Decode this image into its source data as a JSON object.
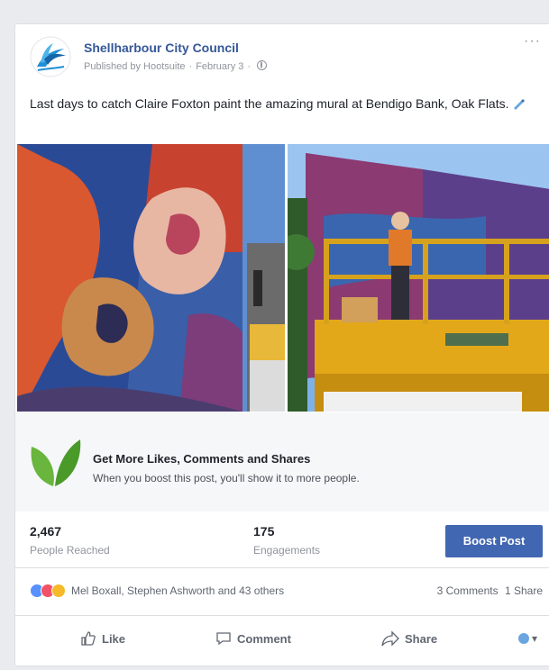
{
  "post": {
    "page_name": "Shellharbour City Council",
    "published_by": "Published by Hootsuite",
    "date": "February 3",
    "more_label": "···",
    "text": "Last days to catch Claire Foxton paint the amazing mural at Bendigo Bank, Oak Flats.",
    "images": [
      "mural-closeup-photo",
      "artist-on-scissor-lift-photo"
    ]
  },
  "promo": {
    "title": "Get More Likes, Comments and Shares",
    "subtitle": "When you boost this post, you'll show it to more people."
  },
  "stats": {
    "reached_value": "2,467",
    "reached_label": "People Reached",
    "engagements_value": "175",
    "engagements_label": "Engagements",
    "boost_label": "Boost Post"
  },
  "reactions": {
    "names": "Mel Boxall, Stephen Ashworth and 43 others",
    "comments": "3 Comments",
    "shares": "1 Share",
    "icons": [
      "like-reaction-icon",
      "love-reaction-icon",
      "wow-reaction-icon"
    ]
  },
  "actions": {
    "like": "Like",
    "comment": "Comment",
    "share": "Share"
  },
  "colors": {
    "link": "#365899",
    "button": "#4267b2",
    "background": "#e9ebee"
  }
}
